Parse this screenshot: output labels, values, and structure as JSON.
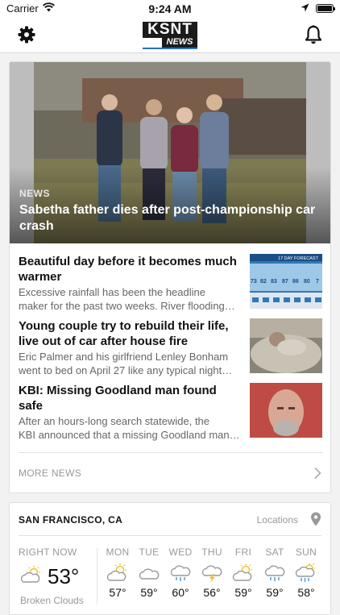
{
  "status_bar": {
    "carrier": "Carrier",
    "time": "9:24 AM"
  },
  "header": {
    "logo_top": "KSNT",
    "logo_bottom": "NEWS"
  },
  "news": {
    "hero": {
      "kicker": "NEWS",
      "headline": "Sabetha father dies after post-championship car crash"
    },
    "stories": [
      {
        "title": "Beautiful day before it becomes much warmer",
        "summary_line1": "Excessive rainfall has been the headline",
        "summary_line2": "maker for the past two weeks. River flooding…",
        "thumb_caption": "17 DAY FORECAST",
        "thumb_temps": [
          "73",
          "82",
          "83",
          "87",
          "86",
          "80",
          "7"
        ]
      },
      {
        "title": "Young couple try to rebuild their life, live out of car after house fire",
        "summary_line1": "Eric Palmer and his girlfriend Lenley Bonham",
        "summary_line2": "went to bed on April 27 like any typical night…"
      },
      {
        "title": "KBI: Missing Goodland man found safe",
        "summary_line1": "After an hours-long search statewide, the",
        "summary_line2": "KBI announced that a missing Goodland man…"
      }
    ],
    "more_label": "MORE NEWS"
  },
  "weather": {
    "city": "SAN FRANCISCO, CA",
    "locations_label": "Locations",
    "now": {
      "label": "RIGHT NOW",
      "temp": "53°",
      "condition": "Broken Clouds",
      "icon": "partly-sunny-icon"
    },
    "forecast": [
      {
        "day": "MON",
        "hi": "57°",
        "icon": "partly-sunny-icon"
      },
      {
        "day": "TUE",
        "hi": "59°",
        "icon": "cloud-icon"
      },
      {
        "day": "WED",
        "hi": "60°",
        "icon": "rain-icon"
      },
      {
        "day": "THU",
        "hi": "56°",
        "icon": "thunderstorm-icon"
      },
      {
        "day": "FRI",
        "hi": "59°",
        "icon": "partly-sunny-icon"
      },
      {
        "day": "SAT",
        "hi": "59°",
        "icon": "rain-icon"
      },
      {
        "day": "SUN",
        "hi": "58°",
        "icon": "sun-rain-icon"
      }
    ]
  },
  "colors": {
    "accent_yellow": "#f2c230",
    "accent_blue": "#5aa3d8",
    "logo_stripe": "#2a6fc9"
  }
}
